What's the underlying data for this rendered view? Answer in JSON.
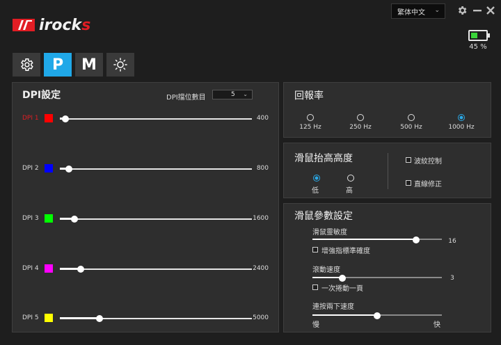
{
  "app": {
    "logo_text_main": "irock",
    "logo_text_accent": "s"
  },
  "language": {
    "selected": "繁体中文"
  },
  "battery": {
    "percent_label": "45 %",
    "level": 0.45
  },
  "tabs": [
    {
      "icon": "gear-icon",
      "label": ""
    },
    {
      "icon": "",
      "label": "P"
    },
    {
      "icon": "",
      "label": "M"
    },
    {
      "icon": "sun-icon",
      "label": ""
    }
  ],
  "dpi": {
    "title": "DPI設定",
    "levels_label": "DPI擋位數目",
    "levels_value": "5",
    "rows": [
      {
        "label": "DPI 1",
        "color": "#ff0000",
        "value": "400",
        "fraction": 0.02,
        "active": true
      },
      {
        "label": "DPI 2",
        "color": "#0000ff",
        "value": "800",
        "fraction": 0.04,
        "active": false
      },
      {
        "label": "DPI 3",
        "color": "#00ff00",
        "value": "1600",
        "fraction": 0.07,
        "active": false
      },
      {
        "label": "DPI 4",
        "color": "#ff00ff",
        "value": "2400",
        "fraction": 0.1,
        "active": false
      },
      {
        "label": "DPI 5",
        "color": "#ffff00",
        "value": "5000",
        "fraction": 0.2,
        "active": false
      }
    ]
  },
  "report_rate": {
    "title": "回報率",
    "options": [
      {
        "label": "125 Hz",
        "selected": false
      },
      {
        "label": "250 Hz",
        "selected": false
      },
      {
        "label": "500 Hz",
        "selected": false
      },
      {
        "label": "1000 Hz",
        "selected": true
      }
    ]
  },
  "lift": {
    "title": "滑鼠抬高高度",
    "low": "低",
    "high": "高",
    "selected": "low",
    "ripple_label": "波紋控制",
    "angle_label": "直線修正"
  },
  "params": {
    "title": "滑鼠參數設定",
    "sensitivity_label": "滑鼠靈敏度",
    "sensitivity_value": "16",
    "sensitivity_fraction": 0.8,
    "precision_label": "增強指標準確度",
    "scroll_label": "滾動速度",
    "scroll_value": "3",
    "scroll_fraction": 0.23,
    "scroll_page_label": "一次捲動一頁",
    "dblclick_label": "連按兩下速度",
    "dblclick_fraction": 0.5,
    "slow_label": "慢",
    "fast_label": "快"
  }
}
